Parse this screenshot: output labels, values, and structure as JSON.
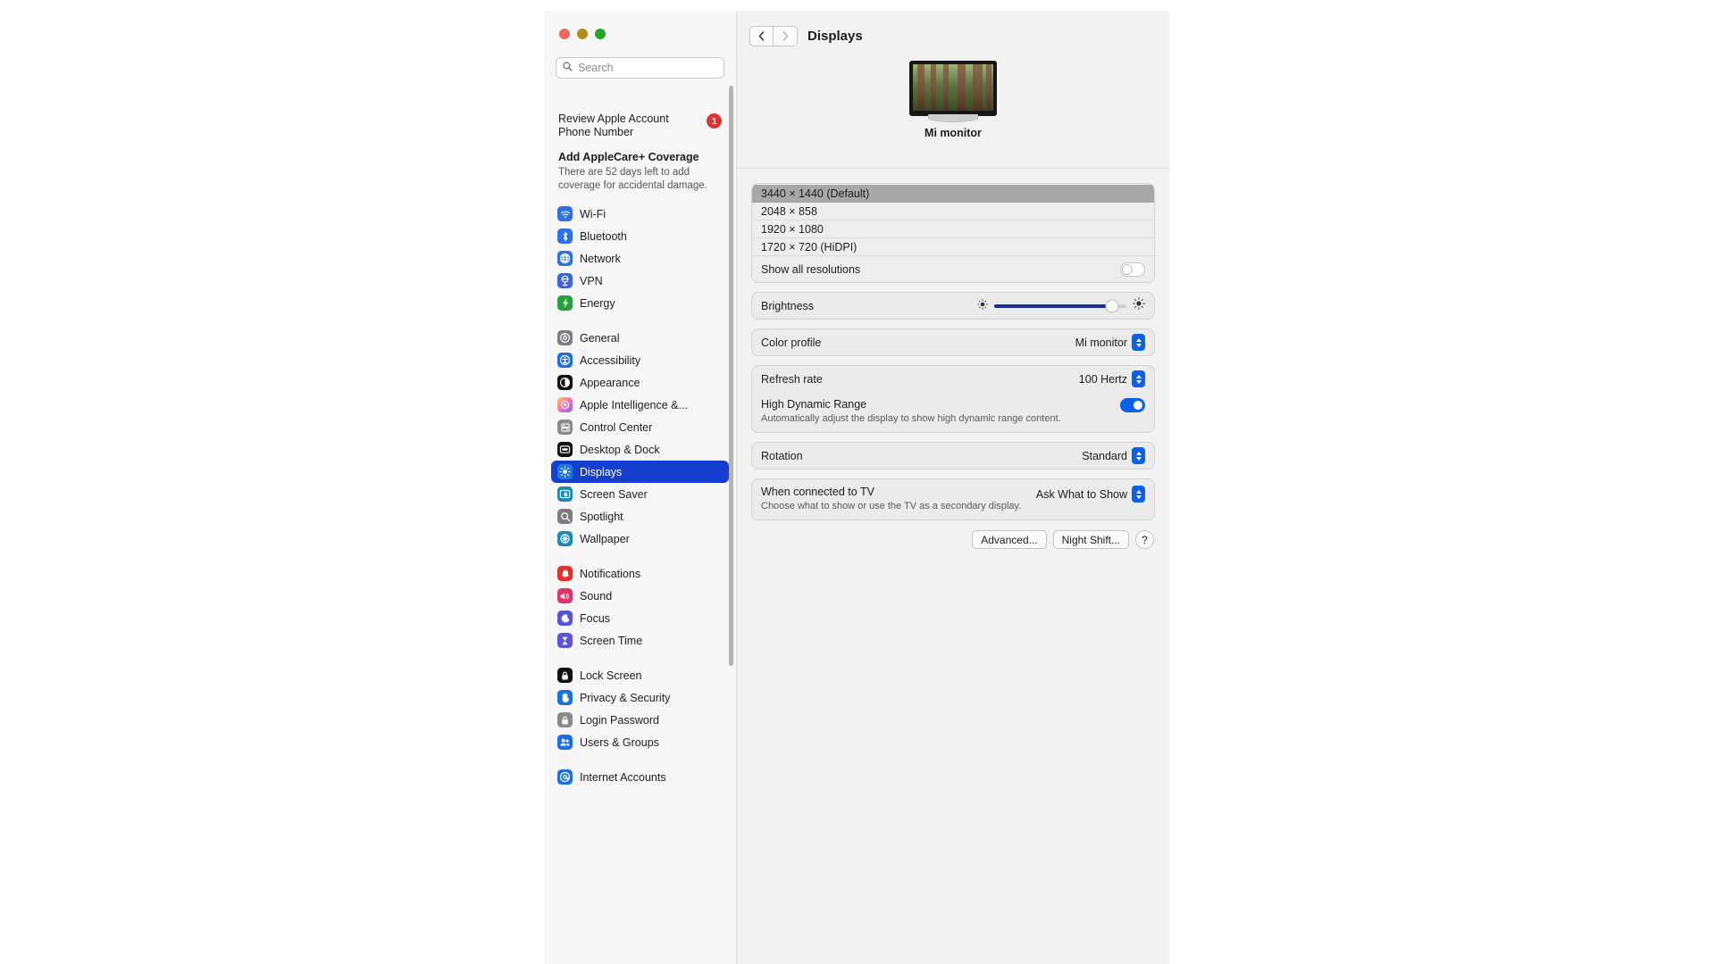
{
  "window": {
    "traffic_lights": [
      "close",
      "minimize",
      "zoom"
    ]
  },
  "sidebar": {
    "search": {
      "placeholder": "Search",
      "value": ""
    },
    "alerts": {
      "account_title": "Review Apple Account Phone Number",
      "account_badge": "1",
      "applecare_title": "Add AppleCare+ Coverage",
      "applecare_sub": "There are 52 days left to add coverage for accidental damage."
    },
    "groups": [
      {
        "items": [
          {
            "label": "Wi-Fi",
            "icon": "wifi-icon",
            "color": "#2f6fe8",
            "glyph": "wifi"
          },
          {
            "label": "Bluetooth",
            "icon": "bluetooth-icon",
            "color": "#2f6fe8",
            "glyph": "bt"
          },
          {
            "label": "Network",
            "icon": "network-icon",
            "color": "#2f6fe8",
            "glyph": "globe"
          },
          {
            "label": "VPN",
            "icon": "vpn-icon",
            "color": "#3f63d8",
            "glyph": "vpn"
          },
          {
            "label": "Energy",
            "icon": "energy-icon",
            "color": "#28a03c",
            "glyph": "bolt"
          }
        ]
      },
      {
        "items": [
          {
            "label": "General",
            "icon": "general-icon",
            "color": "#7e7e82",
            "glyph": "gear"
          },
          {
            "label": "Accessibility",
            "icon": "accessibility-icon",
            "color": "#1c6fe0",
            "glyph": "person"
          },
          {
            "label": "Appearance",
            "icon": "appearance-icon",
            "color": "#111111",
            "glyph": "contrast"
          },
          {
            "label": "Apple Intelligence &...",
            "icon": "apple-intelligence-icon",
            "color": "#e0569a",
            "glyph": "sparkle"
          },
          {
            "label": "Control Center",
            "icon": "control-center-icon",
            "color": "#8a8a8e",
            "glyph": "sliders"
          },
          {
            "label": "Desktop & Dock",
            "icon": "desktop-dock-icon",
            "color": "#111111",
            "glyph": "dock"
          },
          {
            "label": "Displays",
            "icon": "displays-icon",
            "color": "#1a7ae8",
            "glyph": "brightness",
            "selected": true
          },
          {
            "label": "Screen Saver",
            "icon": "screen-saver-icon",
            "color": "#1a88b8",
            "glyph": "screensaver"
          },
          {
            "label": "Spotlight",
            "icon": "spotlight-icon",
            "color": "#7e7e82",
            "glyph": "search"
          },
          {
            "label": "Wallpaper",
            "icon": "wallpaper-icon",
            "color": "#1a88b8",
            "glyph": "flower"
          }
        ]
      },
      {
        "items": [
          {
            "label": "Notifications",
            "icon": "notifications-icon",
            "color": "#e0332e",
            "glyph": "bell"
          },
          {
            "label": "Sound",
            "icon": "sound-icon",
            "color": "#e0336a",
            "glyph": "speaker"
          },
          {
            "label": "Focus",
            "icon": "focus-icon",
            "color": "#5a55d8",
            "glyph": "moon"
          },
          {
            "label": "Screen Time",
            "icon": "screen-time-icon",
            "color": "#5a55d8",
            "glyph": "hourglass"
          }
        ]
      },
      {
        "items": [
          {
            "label": "Lock Screen",
            "icon": "lock-screen-icon",
            "color": "#111111",
            "glyph": "lock"
          },
          {
            "label": "Privacy & Security",
            "icon": "privacy-security-icon",
            "color": "#1c6fe0",
            "glyph": "hand"
          },
          {
            "label": "Login Password",
            "icon": "login-password-icon",
            "color": "#8a8a8e",
            "glyph": "lock"
          },
          {
            "label": "Users & Groups",
            "icon": "users-groups-icon",
            "color": "#1c6fe0",
            "glyph": "people"
          }
        ]
      },
      {
        "items": [
          {
            "label": "Internet Accounts",
            "icon": "internet-accounts-icon",
            "color": "#1c6fe0",
            "glyph": "at"
          }
        ]
      }
    ]
  },
  "main": {
    "title": "Displays",
    "nav": {
      "back": "‹",
      "forward": "›"
    },
    "display_name": "Mi monitor",
    "resolutions": [
      {
        "label": "3440 × 1440 (Default)",
        "selected": true
      },
      {
        "label": "2048 × 858",
        "selected": false
      },
      {
        "label": "1920 × 1080",
        "selected": false
      },
      {
        "label": "1720 × 720 (HiDPI)",
        "selected": false
      }
    ],
    "show_all_resolutions": {
      "label": "Show all resolutions",
      "on": false
    },
    "brightness": {
      "label": "Brightness",
      "value": 89
    },
    "color_profile": {
      "label": "Color profile",
      "value": "Mi monitor"
    },
    "refresh_rate": {
      "label": "Refresh rate",
      "value": "100 Hertz"
    },
    "hdr": {
      "label": "High Dynamic Range",
      "sub": "Automatically adjust the display to show high dynamic range content.",
      "on": true
    },
    "rotation": {
      "label": "Rotation",
      "value": "Standard"
    },
    "tv": {
      "label": "When connected to TV",
      "sub": "Choose what to show or use the TV as a secondary display.",
      "value": "Ask What to Show"
    },
    "buttons": {
      "advanced": "Advanced...",
      "night_shift": "Night Shift...",
      "help": "?"
    }
  },
  "colors": {
    "accent": "#0a61e8",
    "selection": "#1540cf",
    "badge": "#e0332e"
  }
}
